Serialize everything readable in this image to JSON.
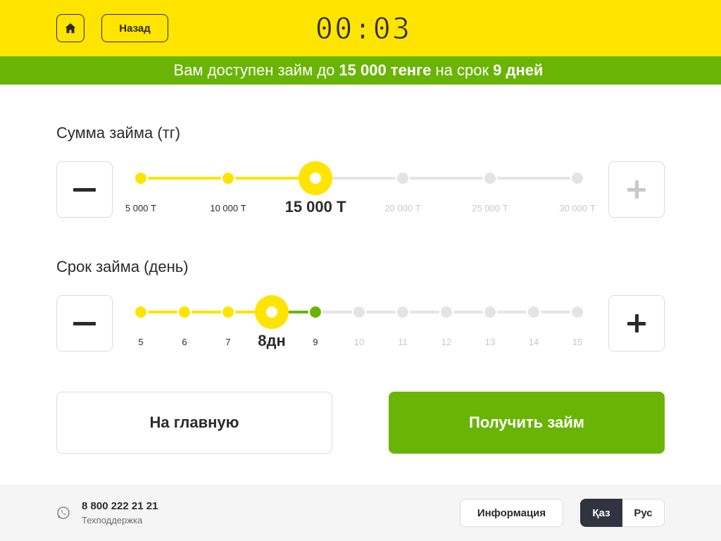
{
  "header": {
    "home_icon": "home-icon",
    "back_label": "Назад",
    "timer": "00:03"
  },
  "banner": {
    "prefix": "Вам доступен займ до",
    "amount": "15 000 тенге",
    "middle": "на срок",
    "term": "9 дней"
  },
  "amount_slider": {
    "title": "Сумма займа (тг)",
    "ticks": [
      "5 000 Т",
      "10 000 Т",
      "15 000 Т",
      "20 000 Т",
      "25 000 Т",
      "30 000 Т"
    ],
    "selected_index": 2
  },
  "term_slider": {
    "title": "Срок займа (день)",
    "ticks": [
      "5",
      "6",
      "7",
      "8дн",
      "9",
      "10",
      "11",
      "12",
      "13",
      "14",
      "15"
    ],
    "selected_index": 3,
    "max_available_index": 4
  },
  "actions": {
    "home_label": "На главную",
    "get_loan_label": "Получить займ"
  },
  "footer": {
    "phone": "8 800 222 21 21",
    "support_label": "Техподдержка",
    "info_label": "Информация",
    "lang_kaz": "Қаз",
    "lang_rus": "Рус",
    "active_lang": "kaz"
  },
  "colors": {
    "yellow": "#ffe400",
    "green": "#6ab406",
    "dark": "#2f3440"
  }
}
